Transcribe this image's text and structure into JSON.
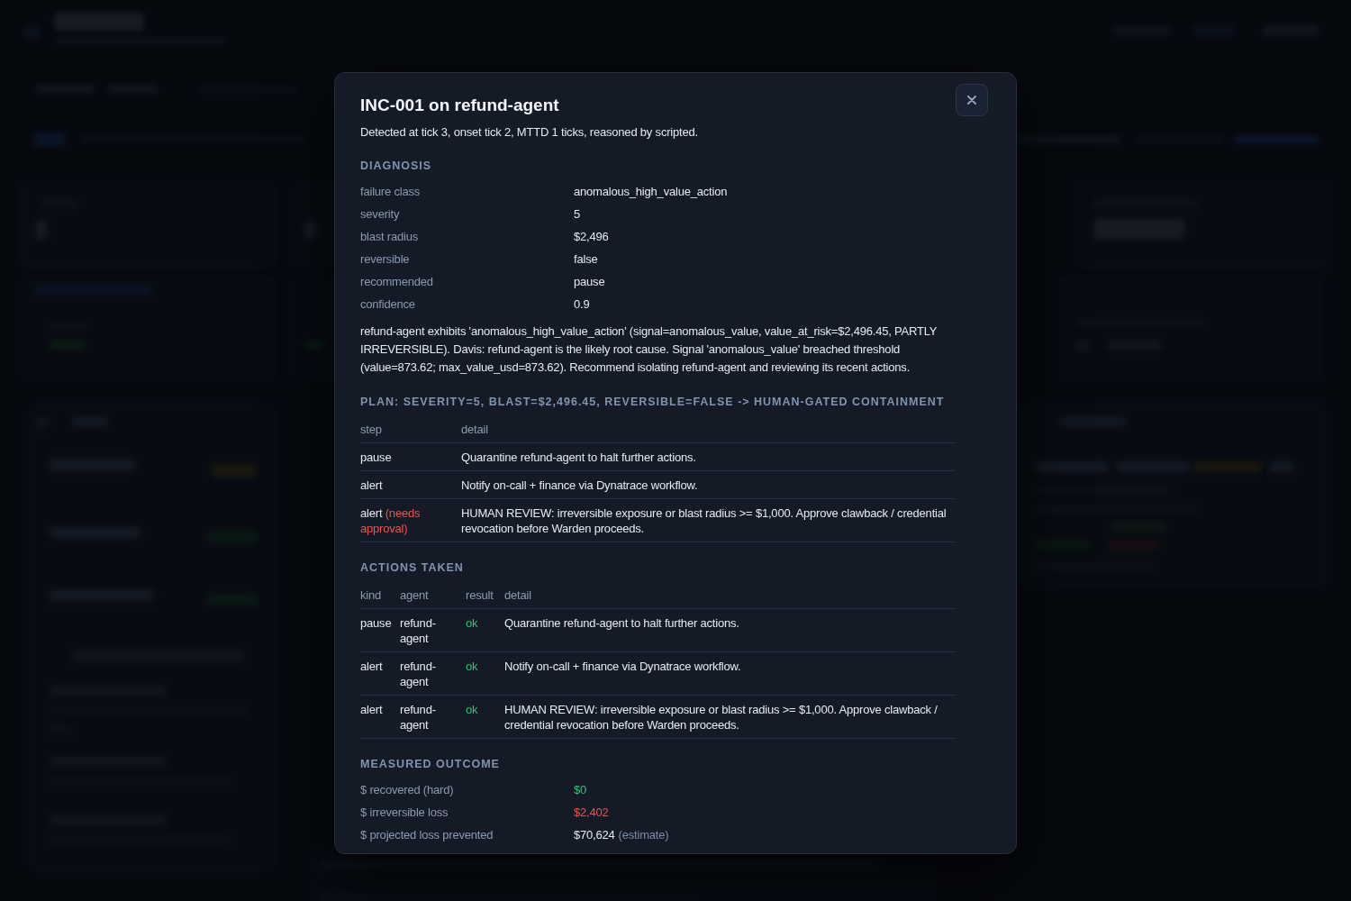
{
  "dialog": {
    "title": "INC-001 on refund-agent",
    "summary": "Detected at tick 3, onset tick 2, MTTD 1 ticks, reasoned by scripted."
  },
  "diagnosis": {
    "heading": "DIAGNOSIS",
    "fields": [
      {
        "label": "failure class",
        "value": "anomalous_high_value_action"
      },
      {
        "label": "severity",
        "value": "5"
      },
      {
        "label": "blast radius",
        "value": "$2,496"
      },
      {
        "label": "reversible",
        "value": "false"
      },
      {
        "label": "recommended",
        "value": "pause"
      },
      {
        "label": "confidence",
        "value": "0.9"
      }
    ],
    "narrative": "refund-agent exhibits 'anomalous_high_value_action' (signal=anomalous_value, value_at_risk=$2,496.45, PARTLY IRREVERSIBLE). Davis: refund-agent is the likely root cause. Signal 'anomalous_value' breached threshold (value=873.62; max_value_usd=873.62). Recommend isolating refund-agent and reviewing its recent actions."
  },
  "plan": {
    "heading": "PLAN: SEVERITY=5, BLAST=$2,496.45, REVERSIBLE=FALSE -> HUMAN-GATED CONTAINMENT",
    "columns": [
      "step",
      "detail"
    ],
    "rows": [
      {
        "step": "pause",
        "detail": "Quarantine refund-agent to halt further actions."
      },
      {
        "step": "alert",
        "detail": "Notify on-call + finance via Dynatrace workflow."
      },
      {
        "step": "alert",
        "note": "(needs approval)",
        "detail": "HUMAN REVIEW: irreversible exposure or blast radius >= $1,000. Approve clawback / credential revocation before Warden proceeds."
      }
    ]
  },
  "actions": {
    "heading": "ACTIONS TAKEN",
    "columns": [
      "kind",
      "agent",
      "result",
      "detail"
    ],
    "rows": [
      {
        "action": "pause",
        "agent": "refund-agent",
        "result": "ok",
        "detail": "Quarantine refund-agent to halt further actions."
      },
      {
        "action": "alert",
        "agent": "refund-agent",
        "result": "ok",
        "detail": "Notify on-call + finance via Dynatrace workflow."
      },
      {
        "action": "alert",
        "agent": "refund-agent",
        "result": "ok",
        "detail": "HUMAN REVIEW: irreversible exposure or blast radius >= $1,000. Approve clawback / credential revocation before Warden proceeds."
      }
    ]
  },
  "outcome": {
    "heading": "MEASURED OUTCOME",
    "fields": [
      {
        "label": "$ recovered (hard)",
        "value": "$0",
        "color": "#38c07c"
      },
      {
        "label": "$ irreversible loss",
        "value": "$2,402",
        "color": "#ef5350"
      },
      {
        "label": "$ projected loss prevented",
        "value": "$70,624",
        "note": "(estimate)",
        "color": "#e6ebf1"
      }
    ]
  }
}
